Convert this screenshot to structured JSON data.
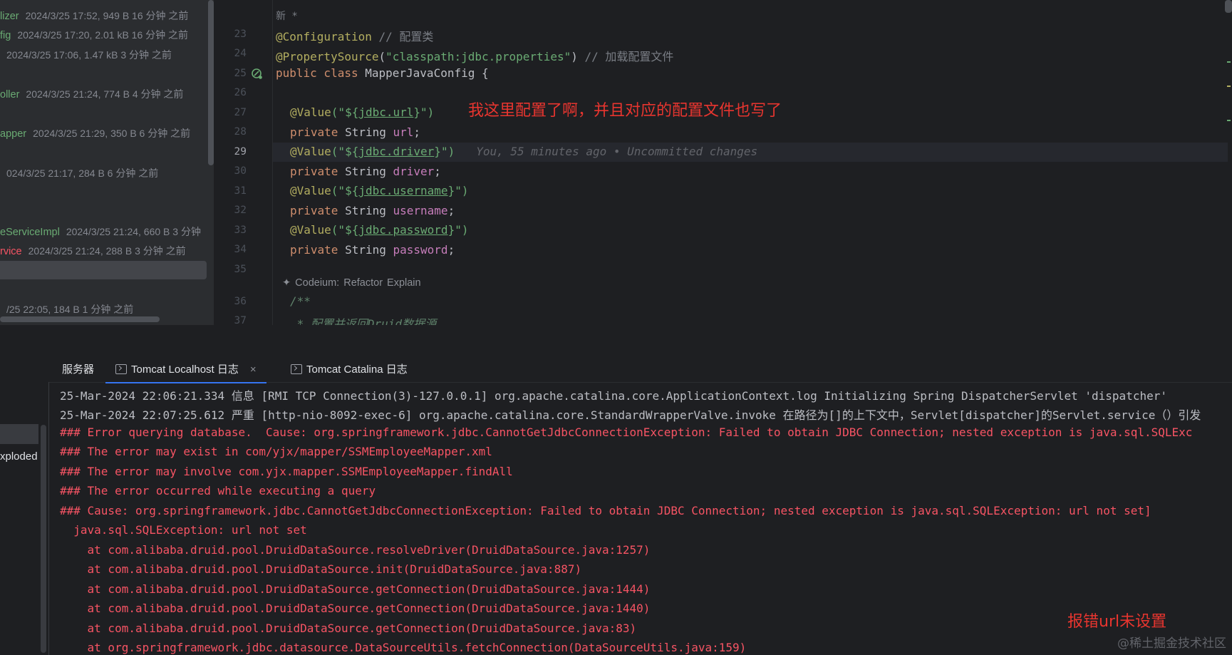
{
  "project_panel": {
    "files": [
      {
        "name": "lizer",
        "meta": "2024/3/25 17:52, 949 B 16 分钟 之前",
        "status": "added"
      },
      {
        "name": "fig",
        "meta": "2024/3/25 17:20, 2.01 kB 16 分钟 之前",
        "status": "added"
      },
      {
        "name": "",
        "meta": "2024/3/25 17:06, 1.47 kB 3 分钟 之前",
        "status": "added"
      },
      {
        "name": "oller",
        "meta": "2024/3/25 21:24, 774 B 4 分钟 之前",
        "status": "added"
      },
      {
        "name": "apper",
        "meta": "2024/3/25 21:29, 350 B 6 分钟 之前",
        "status": "added"
      },
      {
        "name": "",
        "meta": "024/3/25 21:17, 284 B 6 分钟 之前",
        "status": "added"
      },
      {
        "name": "eServiceImpl",
        "meta": "2024/3/25 21:24, 660 B 3 分钟",
        "status": "added"
      },
      {
        "name": "rvice",
        "meta": "2024/3/25 21:24, 288 B 3 分钟 之前",
        "status": "error"
      },
      {
        "name": "",
        "meta": "/25 22:05, 184 B 1 分钟 之前",
        "status": "added"
      }
    ]
  },
  "editor": {
    "header_line": "新 *",
    "line_numbers": [
      "23",
      "24",
      "25",
      "26",
      "27",
      "28",
      "29",
      "30",
      "31",
      "32",
      "33",
      "34",
      "35",
      "36",
      "37"
    ],
    "current_line": "29",
    "lines": {
      "l23_ann": "@Configuration",
      "l23_cmt": " // 配置类",
      "l24_ann": "@PropertySource",
      "l24_open": "(",
      "l24_str": "\"classpath:jdbc.properties\"",
      "l24_close": ")",
      "l24_cmt": " // 加载配置文件",
      "l25_kw": "public class ",
      "l25_name": "MapperJavaConfig {",
      "value_ann": "@Value",
      "open": "(\"",
      "close": "\")",
      "dollar": "${",
      "brace": "}",
      "private_kw": "private ",
      "string_type": "String ",
      "semicolon": ";",
      "l27_prop": "jdbc.url",
      "l28_field": "url",
      "l29_prop": "jdbc.driver",
      "l29_blame": "You, 55 minutes ago • Uncommitted changes",
      "l30_field": "driver",
      "l31_prop": "jdbc.username",
      "l32_field": "username",
      "l33_prop": "jdbc.password",
      "l34_field": "password",
      "l36_cmt": "/**",
      "l37_cmt": " * 配置并返回Druid数据源。"
    },
    "codeium": {
      "prefix": "Codeium:",
      "refactor": "Refactor",
      "explain": "Explain"
    },
    "note": "我这里配置了啊，并且对应的配置文件也写了"
  },
  "tool_window": {
    "tabs": [
      {
        "label": "服务器"
      },
      {
        "label": "Tomcat Localhost 日志",
        "close": "×"
      },
      {
        "label": "Tomcat Catalina 日志"
      }
    ],
    "sidebar_label": "xploded [",
    "log_lines": [
      {
        "text": "25-Mar-2024 22:06:21.334 信息 [RMI TCP Connection(3)-127.0.0.1] org.apache.catalina.core.ApplicationContext.log Initializing Spring DispatcherServlet 'dispatcher'",
        "level": "info"
      },
      {
        "text": "25-Mar-2024 22:07:25.612 严重 [http-nio-8092-exec-6] org.apache.catalina.core.StandardWrapperValve.invoke 在路径为[]的上下文中，Servlet[dispatcher]的Servlet.service（）引发",
        "level": "info"
      },
      {
        "text": "### Error querying database.  Cause: org.springframework.jdbc.CannotGetJdbcConnectionException: Failed to obtain JDBC Connection; nested exception is java.sql.SQLExc",
        "level": "error"
      },
      {
        "text": "### The error may exist in com/yjx/mapper/SSMEmployeeMapper.xml",
        "level": "error"
      },
      {
        "text": "### The error may involve com.yjx.mapper.SSMEmployeeMapper.findAll",
        "level": "error"
      },
      {
        "text": "### The error occurred while executing a query",
        "level": "error"
      },
      {
        "text": "### Cause: org.springframework.jdbc.CannotGetJdbcConnectionException: Failed to obtain JDBC Connection; nested exception is java.sql.SQLException: url not set]",
        "level": "error"
      },
      {
        "text": "  java.sql.SQLException: url not set",
        "level": "error"
      },
      {
        "text": "    at com.alibaba.druid.pool.DruidDataSource.resolveDriver(DruidDataSource.java:1257)",
        "level": "error"
      },
      {
        "text": "    at com.alibaba.druid.pool.DruidDataSource.init(DruidDataSource.java:887)",
        "level": "error"
      },
      {
        "text": "    at com.alibaba.druid.pool.DruidDataSource.getConnection(DruidDataSource.java:1444)",
        "level": "error"
      },
      {
        "text": "    at com.alibaba.druid.pool.DruidDataSource.getConnection(DruidDataSource.java:1440)",
        "level": "error"
      },
      {
        "text": "    at com.alibaba.druid.pool.DruidDataSource.getConnection(DruidDataSource.java:83)",
        "level": "error"
      },
      {
        "text": "    at org.springframework.jdbc.datasource.DataSourceUtils.fetchConnection(DataSourceUtils.java:159)",
        "level": "error"
      }
    ],
    "note": "报错url未设置"
  },
  "watermark": "@稀土掘金技术社区",
  "colors": {
    "accent": "#3574f0",
    "error": "#f75464",
    "annotation_note": "#e8352f",
    "added_file": "#6aab73"
  }
}
